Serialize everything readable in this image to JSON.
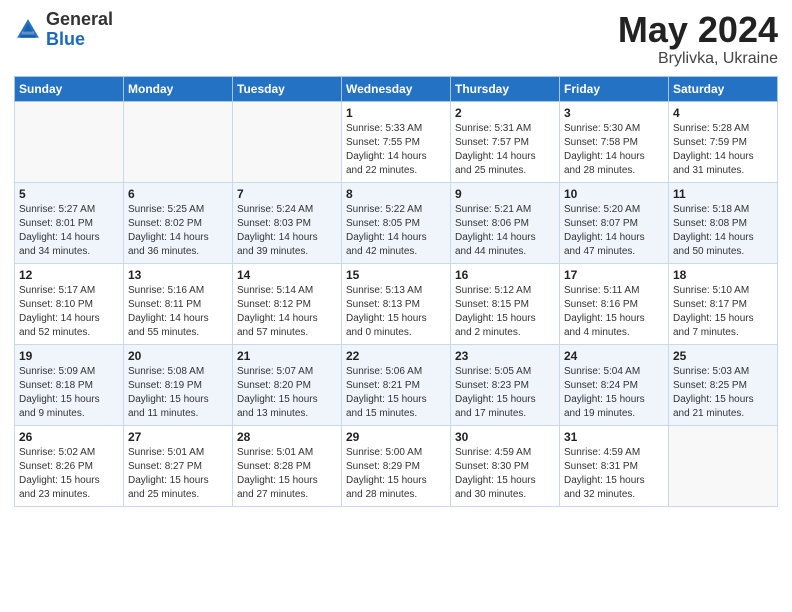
{
  "header": {
    "logo_general": "General",
    "logo_blue": "Blue",
    "title_month": "May 2024",
    "title_location": "Brylivka, Ukraine"
  },
  "weekdays": [
    "Sunday",
    "Monday",
    "Tuesday",
    "Wednesday",
    "Thursday",
    "Friday",
    "Saturday"
  ],
  "weeks": [
    [
      {
        "day": "",
        "sunrise": "",
        "sunset": "",
        "daylight": ""
      },
      {
        "day": "",
        "sunrise": "",
        "sunset": "",
        "daylight": ""
      },
      {
        "day": "",
        "sunrise": "",
        "sunset": "",
        "daylight": ""
      },
      {
        "day": "1",
        "sunrise": "Sunrise: 5:33 AM",
        "sunset": "Sunset: 7:55 PM",
        "daylight": "Daylight: 14 hours and 22 minutes."
      },
      {
        "day": "2",
        "sunrise": "Sunrise: 5:31 AM",
        "sunset": "Sunset: 7:57 PM",
        "daylight": "Daylight: 14 hours and 25 minutes."
      },
      {
        "day": "3",
        "sunrise": "Sunrise: 5:30 AM",
        "sunset": "Sunset: 7:58 PM",
        "daylight": "Daylight: 14 hours and 28 minutes."
      },
      {
        "day": "4",
        "sunrise": "Sunrise: 5:28 AM",
        "sunset": "Sunset: 7:59 PM",
        "daylight": "Daylight: 14 hours and 31 minutes."
      }
    ],
    [
      {
        "day": "5",
        "sunrise": "Sunrise: 5:27 AM",
        "sunset": "Sunset: 8:01 PM",
        "daylight": "Daylight: 14 hours and 34 minutes."
      },
      {
        "day": "6",
        "sunrise": "Sunrise: 5:25 AM",
        "sunset": "Sunset: 8:02 PM",
        "daylight": "Daylight: 14 hours and 36 minutes."
      },
      {
        "day": "7",
        "sunrise": "Sunrise: 5:24 AM",
        "sunset": "Sunset: 8:03 PM",
        "daylight": "Daylight: 14 hours and 39 minutes."
      },
      {
        "day": "8",
        "sunrise": "Sunrise: 5:22 AM",
        "sunset": "Sunset: 8:05 PM",
        "daylight": "Daylight: 14 hours and 42 minutes."
      },
      {
        "day": "9",
        "sunrise": "Sunrise: 5:21 AM",
        "sunset": "Sunset: 8:06 PM",
        "daylight": "Daylight: 14 hours and 44 minutes."
      },
      {
        "day": "10",
        "sunrise": "Sunrise: 5:20 AM",
        "sunset": "Sunset: 8:07 PM",
        "daylight": "Daylight: 14 hours and 47 minutes."
      },
      {
        "day": "11",
        "sunrise": "Sunrise: 5:18 AM",
        "sunset": "Sunset: 8:08 PM",
        "daylight": "Daylight: 14 hours and 50 minutes."
      }
    ],
    [
      {
        "day": "12",
        "sunrise": "Sunrise: 5:17 AM",
        "sunset": "Sunset: 8:10 PM",
        "daylight": "Daylight: 14 hours and 52 minutes."
      },
      {
        "day": "13",
        "sunrise": "Sunrise: 5:16 AM",
        "sunset": "Sunset: 8:11 PM",
        "daylight": "Daylight: 14 hours and 55 minutes."
      },
      {
        "day": "14",
        "sunrise": "Sunrise: 5:14 AM",
        "sunset": "Sunset: 8:12 PM",
        "daylight": "Daylight: 14 hours and 57 minutes."
      },
      {
        "day": "15",
        "sunrise": "Sunrise: 5:13 AM",
        "sunset": "Sunset: 8:13 PM",
        "daylight": "Daylight: 15 hours and 0 minutes."
      },
      {
        "day": "16",
        "sunrise": "Sunrise: 5:12 AM",
        "sunset": "Sunset: 8:15 PM",
        "daylight": "Daylight: 15 hours and 2 minutes."
      },
      {
        "day": "17",
        "sunrise": "Sunrise: 5:11 AM",
        "sunset": "Sunset: 8:16 PM",
        "daylight": "Daylight: 15 hours and 4 minutes."
      },
      {
        "day": "18",
        "sunrise": "Sunrise: 5:10 AM",
        "sunset": "Sunset: 8:17 PM",
        "daylight": "Daylight: 15 hours and 7 minutes."
      }
    ],
    [
      {
        "day": "19",
        "sunrise": "Sunrise: 5:09 AM",
        "sunset": "Sunset: 8:18 PM",
        "daylight": "Daylight: 15 hours and 9 minutes."
      },
      {
        "day": "20",
        "sunrise": "Sunrise: 5:08 AM",
        "sunset": "Sunset: 8:19 PM",
        "daylight": "Daylight: 15 hours and 11 minutes."
      },
      {
        "day": "21",
        "sunrise": "Sunrise: 5:07 AM",
        "sunset": "Sunset: 8:20 PM",
        "daylight": "Daylight: 15 hours and 13 minutes."
      },
      {
        "day": "22",
        "sunrise": "Sunrise: 5:06 AM",
        "sunset": "Sunset: 8:21 PM",
        "daylight": "Daylight: 15 hours and 15 minutes."
      },
      {
        "day": "23",
        "sunrise": "Sunrise: 5:05 AM",
        "sunset": "Sunset: 8:23 PM",
        "daylight": "Daylight: 15 hours and 17 minutes."
      },
      {
        "day": "24",
        "sunrise": "Sunrise: 5:04 AM",
        "sunset": "Sunset: 8:24 PM",
        "daylight": "Daylight: 15 hours and 19 minutes."
      },
      {
        "day": "25",
        "sunrise": "Sunrise: 5:03 AM",
        "sunset": "Sunset: 8:25 PM",
        "daylight": "Daylight: 15 hours and 21 minutes."
      }
    ],
    [
      {
        "day": "26",
        "sunrise": "Sunrise: 5:02 AM",
        "sunset": "Sunset: 8:26 PM",
        "daylight": "Daylight: 15 hours and 23 minutes."
      },
      {
        "day": "27",
        "sunrise": "Sunrise: 5:01 AM",
        "sunset": "Sunset: 8:27 PM",
        "daylight": "Daylight: 15 hours and 25 minutes."
      },
      {
        "day": "28",
        "sunrise": "Sunrise: 5:01 AM",
        "sunset": "Sunset: 8:28 PM",
        "daylight": "Daylight: 15 hours and 27 minutes."
      },
      {
        "day": "29",
        "sunrise": "Sunrise: 5:00 AM",
        "sunset": "Sunset: 8:29 PM",
        "daylight": "Daylight: 15 hours and 28 minutes."
      },
      {
        "day": "30",
        "sunrise": "Sunrise: 4:59 AM",
        "sunset": "Sunset: 8:30 PM",
        "daylight": "Daylight: 15 hours and 30 minutes."
      },
      {
        "day": "31",
        "sunrise": "Sunrise: 4:59 AM",
        "sunset": "Sunset: 8:31 PM",
        "daylight": "Daylight: 15 hours and 32 minutes."
      },
      {
        "day": "",
        "sunrise": "",
        "sunset": "",
        "daylight": ""
      }
    ]
  ]
}
